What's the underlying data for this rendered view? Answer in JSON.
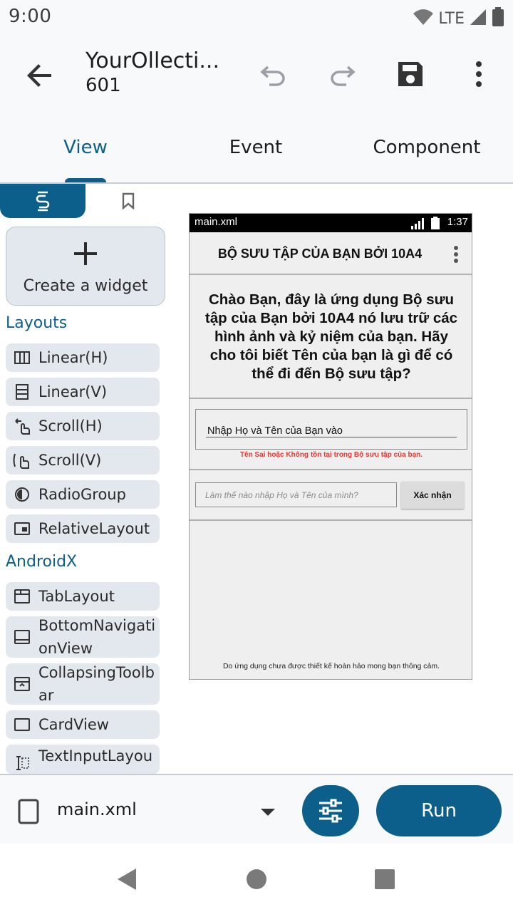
{
  "status_bar": {
    "time": "9:00",
    "network": "LTE",
    "icons": [
      "wifi-icon",
      "signal-icon",
      "battery-icon"
    ]
  },
  "app_bar": {
    "title": "YourOllecti...",
    "subtitle": "601",
    "icons": [
      "back-arrow-icon",
      "undo-icon",
      "redo-icon",
      "save-icon",
      "more-vert-icon"
    ]
  },
  "tabs": [
    {
      "label": "View",
      "active": true
    },
    {
      "label": "Event",
      "active": false
    },
    {
      "label": "Component",
      "active": false
    }
  ],
  "sidebar": {
    "tab_icons": [
      "widget-palette-icon",
      "bookmark-icon"
    ],
    "create_widget_label": "Create a widget",
    "sections": [
      {
        "label": "Layouts",
        "items": [
          {
            "label": "Linear(H)",
            "icon": "linear-horizontal-icon"
          },
          {
            "label": "Linear(V)",
            "icon": "linear-vertical-icon"
          },
          {
            "label": "Scroll(H)",
            "icon": "scroll-horizontal-icon"
          },
          {
            "label": "Scroll(V)",
            "icon": "scroll-vertical-icon"
          },
          {
            "label": "RadioGroup",
            "icon": "radio-group-icon"
          },
          {
            "label": "RelativeLayout",
            "icon": "relative-layout-icon"
          }
        ]
      },
      {
        "label": "AndroidX",
        "items": [
          {
            "label": "TabLayout",
            "icon": "tab-layout-icon"
          },
          {
            "label": "BottomNavigationView",
            "icon": "bottom-navigation-icon"
          },
          {
            "label": "CollapsingToolbar",
            "icon": "collapsing-toolbar-icon"
          },
          {
            "label": "CardView",
            "icon": "card-view-icon"
          },
          {
            "label": "TextInputLayou",
            "icon": "text-input-layout-icon"
          }
        ]
      }
    ]
  },
  "preview": {
    "file_name": "main.xml",
    "time": "1:37",
    "toolbar_title": "BỘ SƯU TẬP CỦA BẠN BỞI 10A4",
    "welcome_text": "Chào Bạn, đây là ứng dụng Bộ sưu tập của Bạn bởi 10A4 nó lưu trữ các hình ảnh và kỷ niệm của bạn. Hãy cho tôi biết Tên của bạn là gì để có thể đi đến Bộ sưu tập?",
    "name_field_text": "Nhập Họ và Tên của Bạn vào",
    "error_text": "Tên Sai hoặc Không tồn tại trong Bộ sưu tập của bạn.",
    "input_placeholder": "Làm thế nào nhập Họ và Tên của mình?",
    "confirm_button": "Xác nhận",
    "footer_text": "Do ứng dụng chưa được thiết kế hoàn hảo mong bạn thông cảm.",
    "error_color": "#e53935"
  },
  "bottom_bar": {
    "file_name": "main.xml",
    "run_label": "Run",
    "icons": [
      "file-icon",
      "dropdown-arrow-icon",
      "tune-icon"
    ]
  },
  "colors": {
    "accent": "#0b5f8a",
    "surface": "#f8f9fb",
    "item_background": "#e3e8ef"
  }
}
